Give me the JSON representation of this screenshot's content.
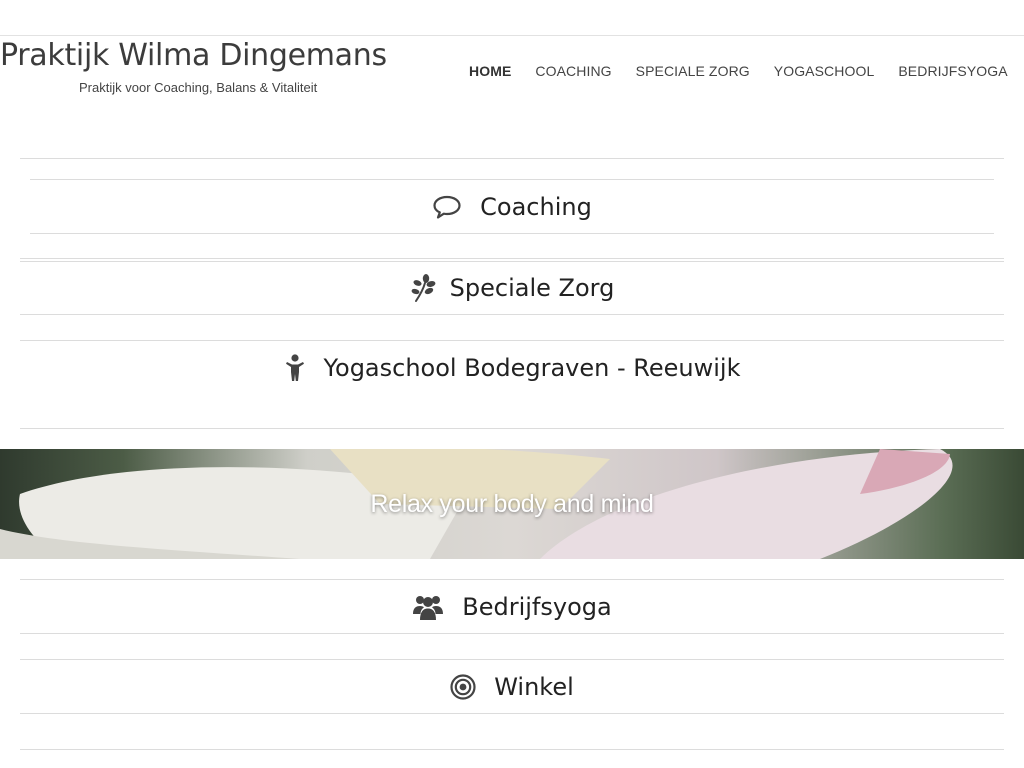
{
  "header": {
    "site_title": "Praktijk Wilma Dingemans",
    "tagline": "Praktijk voor Coaching, Balans & Vitaliteit"
  },
  "nav": {
    "items": [
      {
        "label": "HOME",
        "active": true
      },
      {
        "label": "COACHING",
        "active": false
      },
      {
        "label": "SPECIALE ZORG",
        "active": false
      },
      {
        "label": "YOGASCHOOL",
        "active": false
      },
      {
        "label": "BEDRIJFSYOGA",
        "active": false
      }
    ]
  },
  "sections": [
    {
      "label": "Coaching",
      "icon": "speech-bubble-icon"
    },
    {
      "label": "Speciale Zorg",
      "icon": "leaf-icon"
    },
    {
      "label": "Yogaschool Bodegraven - Reeuwijk",
      "icon": "child-figure-icon"
    },
    {
      "label": "Bedrijfsyoga",
      "icon": "group-icon"
    },
    {
      "label": "Winkel",
      "icon": "target-icon"
    }
  ],
  "banner": {
    "caption": "Relax your body and mind"
  },
  "colors": {
    "text": "#222222",
    "nav_text": "#444444",
    "divider": "#dcdcdc",
    "icon": "#444444",
    "banner_caption": "#ffffff"
  }
}
